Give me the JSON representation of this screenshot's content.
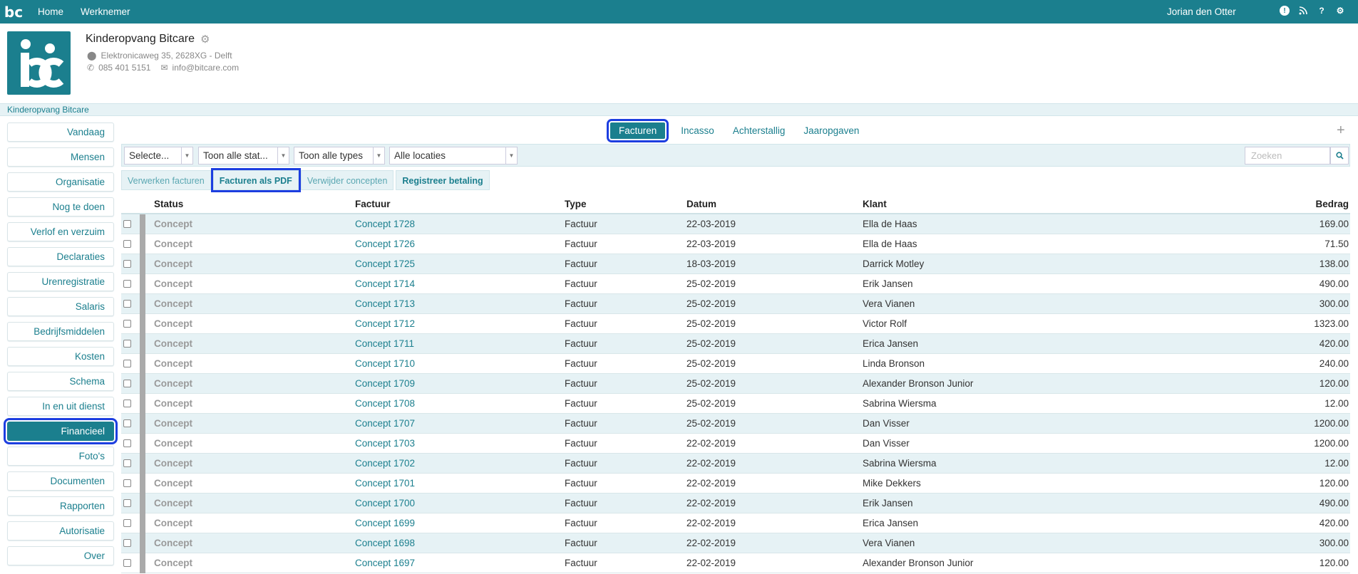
{
  "topbar": {
    "logo": "bc",
    "nav": [
      "Home",
      "Werknemer"
    ],
    "user": "Jorian den Otter",
    "icons": [
      "info-icon",
      "rss-icon",
      "help-icon",
      "gear-icon"
    ]
  },
  "company": {
    "name": "Kinderopvang Bitcare",
    "address": "Elektronicaweg 35, 2628XG - Delft",
    "phone": "085 401 5151",
    "email": "info@bitcare.com"
  },
  "breadcrumb": "Kinderopvang Bitcare",
  "sidebar": {
    "items": [
      {
        "label": "Vandaag",
        "active": false
      },
      {
        "label": "Mensen",
        "active": false
      },
      {
        "label": "Organisatie",
        "active": false
      },
      {
        "label": "Nog te doen",
        "active": false
      },
      {
        "label": "Verlof en verzuim",
        "active": false
      },
      {
        "label": "Declaraties",
        "active": false
      },
      {
        "label": "Urenregistratie",
        "active": false
      },
      {
        "label": "Salaris",
        "active": false
      },
      {
        "label": "Bedrijfsmiddelen",
        "active": false
      },
      {
        "label": "Kosten",
        "active": false
      },
      {
        "label": "Schema",
        "active": false
      },
      {
        "label": "In en uit dienst",
        "active": false
      },
      {
        "label": "Financieel",
        "active": true
      },
      {
        "label": "Foto's",
        "active": false
      },
      {
        "label": "Documenten",
        "active": false
      },
      {
        "label": "Rapporten",
        "active": false
      },
      {
        "label": "Autorisatie",
        "active": false
      },
      {
        "label": "Over",
        "active": false
      }
    ]
  },
  "tabs": [
    {
      "label": "Facturen",
      "active": true
    },
    {
      "label": "Incasso",
      "active": false
    },
    {
      "label": "Achterstallig",
      "active": false
    },
    {
      "label": "Jaaropgaven",
      "active": false
    }
  ],
  "filters": {
    "select1": "Selecte...",
    "select2": "Toon alle stat...",
    "select3": "Toon alle types",
    "select4": "Alle locaties",
    "search_placeholder": "Zoeken"
  },
  "actions": {
    "verwerken": "Verwerken facturen",
    "pdf": "Facturen als PDF",
    "verwijder": "Verwijder concepten",
    "registreer": "Registreer betaling"
  },
  "table": {
    "headers": {
      "status": "Status",
      "factuur": "Factuur",
      "type": "Type",
      "datum": "Datum",
      "klant": "Klant",
      "bedrag": "Bedrag"
    },
    "rows": [
      {
        "status": "Concept",
        "factuur": "Concept 1728",
        "type": "Factuur",
        "datum": "22-03-2019",
        "klant": "Ella de Haas",
        "bedrag": "169.00"
      },
      {
        "status": "Concept",
        "factuur": "Concept 1726",
        "type": "Factuur",
        "datum": "22-03-2019",
        "klant": "Ella de Haas",
        "bedrag": "71.50"
      },
      {
        "status": "Concept",
        "factuur": "Concept 1725",
        "type": "Factuur",
        "datum": "18-03-2019",
        "klant": "Darrick Motley",
        "bedrag": "138.00"
      },
      {
        "status": "Concept",
        "factuur": "Concept 1714",
        "type": "Factuur",
        "datum": "25-02-2019",
        "klant": "Erik Jansen",
        "bedrag": "490.00"
      },
      {
        "status": "Concept",
        "factuur": "Concept 1713",
        "type": "Factuur",
        "datum": "25-02-2019",
        "klant": "Vera Vianen",
        "bedrag": "300.00"
      },
      {
        "status": "Concept",
        "factuur": "Concept 1712",
        "type": "Factuur",
        "datum": "25-02-2019",
        "klant": "Victor Rolf",
        "bedrag": "1323.00"
      },
      {
        "status": "Concept",
        "factuur": "Concept 1711",
        "type": "Factuur",
        "datum": "25-02-2019",
        "klant": "Erica Jansen",
        "bedrag": "420.00"
      },
      {
        "status": "Concept",
        "factuur": "Concept 1710",
        "type": "Factuur",
        "datum": "25-02-2019",
        "klant": "Linda Bronson",
        "bedrag": "240.00"
      },
      {
        "status": "Concept",
        "factuur": "Concept 1709",
        "type": "Factuur",
        "datum": "25-02-2019",
        "klant": "Alexander Bronson Junior",
        "bedrag": "120.00"
      },
      {
        "status": "Concept",
        "factuur": "Concept 1708",
        "type": "Factuur",
        "datum": "25-02-2019",
        "klant": "Sabrina Wiersma",
        "bedrag": "12.00"
      },
      {
        "status": "Concept",
        "factuur": "Concept 1707",
        "type": "Factuur",
        "datum": "25-02-2019",
        "klant": "Dan Visser",
        "bedrag": "1200.00"
      },
      {
        "status": "Concept",
        "factuur": "Concept 1703",
        "type": "Factuur",
        "datum": "22-02-2019",
        "klant": "Dan Visser",
        "bedrag": "1200.00"
      },
      {
        "status": "Concept",
        "factuur": "Concept 1702",
        "type": "Factuur",
        "datum": "22-02-2019",
        "klant": "Sabrina Wiersma",
        "bedrag": "12.00"
      },
      {
        "status": "Concept",
        "factuur": "Concept 1701",
        "type": "Factuur",
        "datum": "22-02-2019",
        "klant": "Mike Dekkers",
        "bedrag": "120.00"
      },
      {
        "status": "Concept",
        "factuur": "Concept 1700",
        "type": "Factuur",
        "datum": "22-02-2019",
        "klant": "Erik Jansen",
        "bedrag": "490.00"
      },
      {
        "status": "Concept",
        "factuur": "Concept 1699",
        "type": "Factuur",
        "datum": "22-02-2019",
        "klant": "Erica Jansen",
        "bedrag": "420.00"
      },
      {
        "status": "Concept",
        "factuur": "Concept 1698",
        "type": "Factuur",
        "datum": "22-02-2019",
        "klant": "Vera Vianen",
        "bedrag": "300.00"
      },
      {
        "status": "Concept",
        "factuur": "Concept 1697",
        "type": "Factuur",
        "datum": "22-02-2019",
        "klant": "Alexander Bronson Junior",
        "bedrag": "120.00"
      }
    ]
  }
}
